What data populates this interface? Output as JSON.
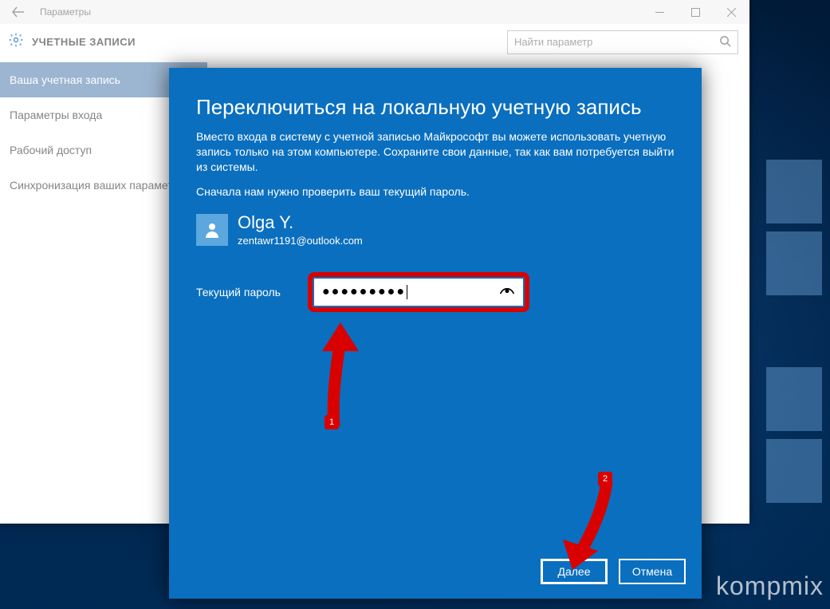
{
  "window": {
    "title": "Параметры",
    "header_title": "УЧЕТНЫЕ ЗАПИСИ",
    "search_placeholder": "Найти параметр"
  },
  "sidebar": {
    "items": [
      {
        "label": "Ваша учетная запись",
        "selected": true
      },
      {
        "label": "Параметры входа",
        "selected": false
      },
      {
        "label": "Рабочий доступ",
        "selected": false
      },
      {
        "label": "Синхронизация ваших параметров",
        "selected": false
      }
    ]
  },
  "modal": {
    "title": "Переключиться на локальную учетную запись",
    "para1": "Вместо входа в систему с учетной записью Майкрософт вы можете использовать учетную запись только на этом компьютере. Сохраните свои данные, так как вам потребуется выйти из системы.",
    "para2": "Сначала нам нужно проверить ваш текущий пароль.",
    "user_name": "Olga Y.",
    "user_email": "zentawr1191@outlook.com",
    "password_label": "Текущий пароль",
    "password_value_mask": "●●●●●●●●●",
    "next_label": "Далее",
    "cancel_label": "Отмена"
  },
  "annotations": {
    "step1": "1",
    "step2": "2"
  },
  "watermark": "kompmix"
}
